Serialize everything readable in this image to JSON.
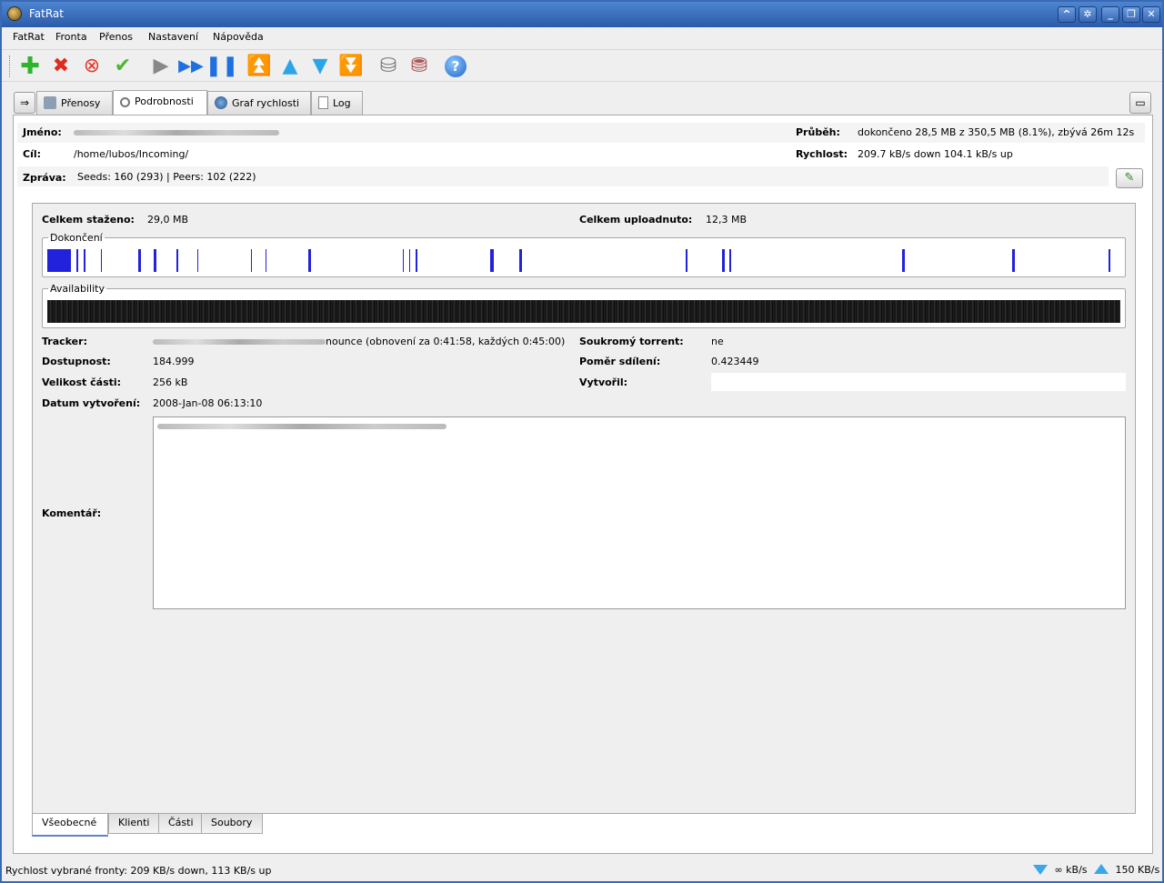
{
  "window": {
    "title": "FatRat"
  },
  "menu": [
    "FatRat",
    "Fronta",
    "Přenos",
    "Nastavení",
    "Nápověda"
  ],
  "toolbar": {
    "icons": [
      "add-icon",
      "delete-icon",
      "delete-with-data-icon",
      "force-check-icon",
      "resume-icon",
      "force-resume-icon",
      "pause-icon",
      "move-top-icon",
      "move-up-icon",
      "move-down-icon",
      "move-bottom-icon",
      "add-queue-icon",
      "remove-queue-icon",
      "help-icon"
    ]
  },
  "tabs": [
    {
      "label": "Přenosy"
    },
    {
      "label": "Podrobnosti"
    },
    {
      "label": "Graf rychlosti"
    },
    {
      "label": "Log"
    }
  ],
  "info": {
    "name_label": "Jméno:",
    "dest_label": "Cíl:",
    "dest_value": "/home/lubos/Incoming/",
    "msg_label": "Zpráva:",
    "msg_value": "Seeds: 160 (293) | Peers: 102 (222)",
    "progress_label": "Průběh:",
    "progress_value": "dokončeno 28,5 MB z 350,5 MB (8.1%), zbývá 26m 12s",
    "speed_label": "Rychlost:",
    "speed_value": "209.7 kB/s down 104.1 kB/s up"
  },
  "general": {
    "downloaded_label": "Celkem staženo:",
    "downloaded_value": "29,0 MB",
    "uploaded_label": "Celkem uploadnuto:",
    "uploaded_value": "12,3 MB",
    "completion_label": "Dokončení",
    "availability_label": "Availability",
    "tracker_label": "Tracker:",
    "tracker_value": "nounce (obnovení za 0:41:58, každých 0:45:00)",
    "private_label": "Soukromý torrent:",
    "private_value": "ne",
    "availability_value_label": "Dostupnost:",
    "availability_value": "184.999",
    "ratio_label": "Poměr sdílení:",
    "ratio_value": "0.423449",
    "piece_label": "Velikost části:",
    "piece_value": "256 kB",
    "creator_label": "Vytvořil:",
    "created_label": "Datum vytvoření:",
    "created_value": "2008-Jan-08 06:13:10",
    "comment_label": "Komentář:"
  },
  "completion_segments": [
    {
      "start": 0.0,
      "width": 0.022
    },
    {
      "start": 0.027,
      "width": 0.002
    },
    {
      "start": 0.034,
      "width": 0.002
    },
    {
      "start": 0.05,
      "width": 0.001
    },
    {
      "start": 0.085,
      "width": 0.002
    },
    {
      "start": 0.099,
      "width": 0.003
    },
    {
      "start": 0.12,
      "width": 0.002
    },
    {
      "start": 0.14,
      "width": 0.001
    },
    {
      "start": 0.19,
      "width": 0.001
    },
    {
      "start": 0.203,
      "width": 0.001
    },
    {
      "start": 0.243,
      "width": 0.003
    },
    {
      "start": 0.331,
      "width": 0.001
    },
    {
      "start": 0.337,
      "width": 0.001
    },
    {
      "start": 0.343,
      "width": 0.002
    },
    {
      "start": 0.413,
      "width": 0.003
    },
    {
      "start": 0.44,
      "width": 0.002
    },
    {
      "start": 0.595,
      "width": 0.002
    },
    {
      "start": 0.629,
      "width": 0.002
    },
    {
      "start": 0.636,
      "width": 0.001
    },
    {
      "start": 0.797,
      "width": 0.002
    },
    {
      "start": 0.899,
      "width": 0.003
    },
    {
      "start": 0.989,
      "width": 0.002
    }
  ],
  "bottom_tabs": [
    "Všeobecné",
    "Klienti",
    "Části",
    "Soubory"
  ],
  "status": {
    "text": "Rychlost vybrané fronty: 209 KB/s down, 113 KB/s up",
    "down_limit": "∞ kB/s",
    "up_limit": "150 KB/s"
  },
  "colors": {
    "accent": "#2a5ba9",
    "completion": "#2222dd"
  }
}
